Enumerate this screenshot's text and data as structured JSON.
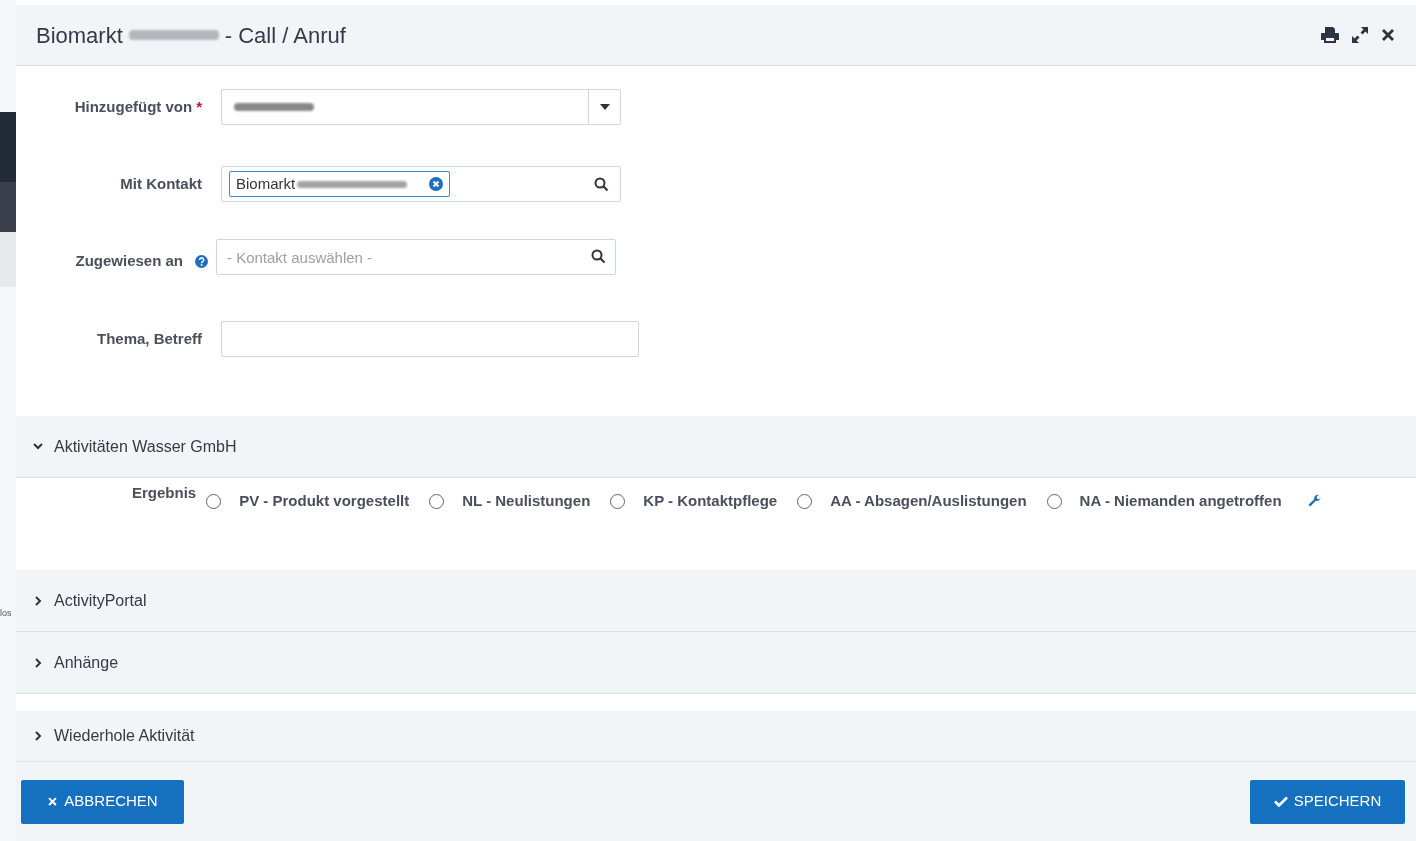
{
  "window": {
    "title_start": "Biomarkt",
    "title_end": "- Call / Anruf"
  },
  "background_text": "los",
  "form": {
    "added_by": {
      "label": "Hinzugefügt von",
      "required": true,
      "required_mark": "*"
    },
    "contact": {
      "label": "Mit Kontakt",
      "chip": "Biomarkt"
    },
    "assigned": {
      "label": "Zugewiesen an",
      "placeholder": "- Kontakt auswählen -"
    },
    "subject": {
      "label": "Thema, Betreff"
    }
  },
  "sections": [
    {
      "title": "Aktivitäten Wasser GmbH",
      "expanded": true,
      "result": {
        "label": "Ergebnis",
        "options": [
          {
            "label": "PV - Produkt vorgestellt",
            "selected": false
          },
          {
            "label": "NL - Neulistungen",
            "selected": false
          },
          {
            "label": "KP - Kontaktpflege",
            "selected": false
          },
          {
            "label": "AA - Absagen/Auslistungen",
            "selected": false
          },
          {
            "label": "NA - Niemanden angetroffen",
            "selected": false
          }
        ]
      }
    },
    {
      "title": "ActivityPortal",
      "expanded": false
    },
    {
      "title": "Anhänge",
      "expanded": false
    },
    {
      "title": "Wiederhole Aktivität",
      "expanded": false
    }
  ],
  "buttons": {
    "cancel": "ABBRECHEN",
    "save": "SPEICHERN"
  }
}
